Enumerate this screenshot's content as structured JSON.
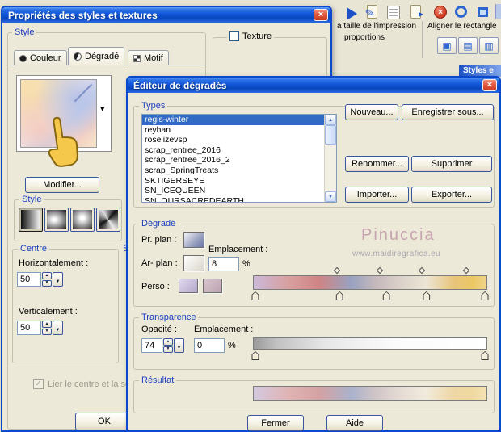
{
  "toolbar": {
    "print_size_label": "a taille de l'impression",
    "proportions_label": "proportions",
    "align_label": "Aligner le rectangle"
  },
  "styles_panel": {
    "title": "Styles e"
  },
  "glyphs": {
    "up": "▲",
    "down": "▼",
    "dropdown": "▼",
    "preview_dropdown": "▾",
    "pencil": "✎",
    "run": "▸",
    "delete": "×",
    "check": "✓",
    "align_a": "▣",
    "align_b": "▤",
    "align_c": "▥"
  },
  "properties_dialog": {
    "title": "Propriétés des styles et textures",
    "close_glyph": "×",
    "style_group_label": "Style",
    "texture_label": "Texture",
    "tabs": [
      {
        "label": "Couleur"
      },
      {
        "label": "Dégradé"
      },
      {
        "label": "Motif"
      }
    ],
    "modify_button": "Modifier...",
    "style_subgroup_label": "Style",
    "centre": {
      "label": "Centre",
      "horizontal_label": "Horizontalement :",
      "horizontal_value": "50",
      "vertical_label": "Verticalement :",
      "vertical_value": "50"
    },
    "partial_group_label": "S",
    "link_checkbox_label": "Lier le centre et la sou",
    "ok_button": "OK"
  },
  "gradient_editor": {
    "title": "Éditeur de dégradés",
    "close_glyph": "×",
    "types": {
      "label": "Types",
      "items": [
        "regis-winter",
        "reyhan",
        "roselizevsp",
        "scrap_rentree_2016",
        "scrap_rentree_2016_2",
        "scrap_SpringTreats",
        "SKTIGERSEYE",
        "SN_ICEQUEEN",
        "SN_OURSACREDEARTH"
      ],
      "selected_index": 0
    },
    "buttons": {
      "new": "Nouveau...",
      "save_as": "Enregistrer sous...",
      "rename": "Renommer...",
      "delete": "Supprimer",
      "import": "Importer...",
      "export": "Exporter..."
    },
    "gradient": {
      "label": "Dégradé",
      "fg_label": "Pr. plan :",
      "bg_label": "Ar- plan :",
      "custom_label": "Perso :",
      "location_label": "Emplacement :",
      "location_value": "8",
      "percent": "%",
      "bar_stops": [
        "#cbb8d8 0%",
        "#d8a0a0 15%",
        "#cf8484 28%",
        "#98a2c0 42%",
        "#c4b8bc 52%",
        "#d9cfc8 62%",
        "#ece5d4 74%",
        "#e8c47c 86%",
        "#ecc763 94%",
        "#f0d489 100%"
      ],
      "stop_positions": [
        1,
        37,
        57,
        74,
        99
      ],
      "mid_positions": [
        36,
        54,
        72,
        91
      ]
    },
    "transparency": {
      "label": "Transparence",
      "opacity_label": "Opacité :",
      "opacity_value": "74",
      "location_label": "Emplacement :",
      "location_value": "0",
      "percent": "%",
      "bar_stops": [
        "#9a9a9a 0%",
        "#c2c2c2 10%",
        "#e6e6e6 30%",
        "#fbfbfb 60%",
        "#ffffff 100%"
      ],
      "stop_positions": [
        1,
        99
      ]
    },
    "result": {
      "label": "Résultat",
      "bar_stops": [
        "#d3c9e0 0%",
        "#e0b4b4 15%",
        "#d4a2a2 28%",
        "#aab2cc 42%",
        "#cfc4c6 52%",
        "#e4dad4 62%",
        "#f1ebdc 74%",
        "#eed7a4 86%",
        "#f0d9a0 94%",
        "#f3e2b2 100%"
      ]
    },
    "close_button": "Fermer",
    "help_button": "Aide"
  },
  "watermark": {
    "name": "Pinuccia",
    "url": "www.maidiregrafica.eu"
  },
  "colors": {
    "titlebar_blue": "#1257D8",
    "selection_blue": "#316AC5",
    "dialog_bg": "#ECE9D8",
    "group_label_blue": "#1B3FBE",
    "close_button_red": "#DF4F36",
    "watermark_pink": "#C7A3AF"
  }
}
